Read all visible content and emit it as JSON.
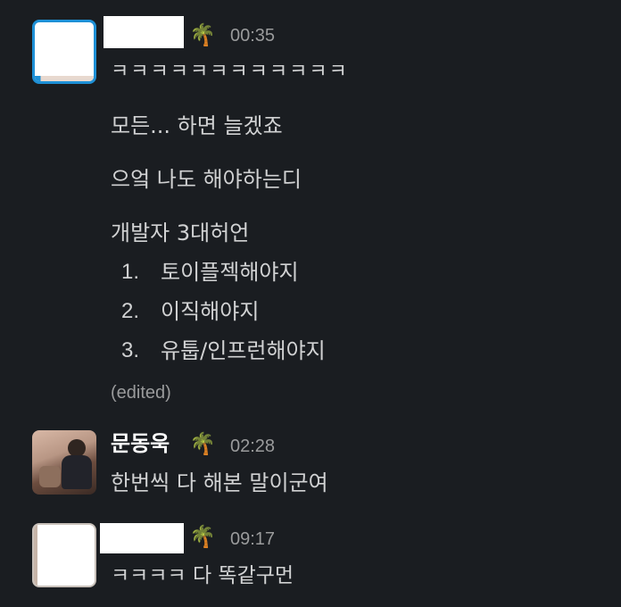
{
  "messages": [
    {
      "author": "",
      "author_status_emoji": "🌴",
      "time": "00:35",
      "lines": [
        "ㅋㅋㅋㅋㅋㅋㅋㅋㅋㅋㅋㅋ",
        "모든... 하면 늘겠죠",
        "으엌 나도 해야하는디",
        "개발자 3대허언"
      ],
      "list": [
        {
          "num": "1.",
          "text": "토이플젝해야지"
        },
        {
          "num": "2.",
          "text": "이직해야지"
        },
        {
          "num": "3.",
          "text": "유툽/인프런해야지"
        }
      ],
      "edited_label": "(edited)"
    },
    {
      "author": "문동욱",
      "author_status_emoji": "🌴",
      "time": "02:28",
      "lines": [
        "한번씩 다 해본 말이군여"
      ]
    },
    {
      "author": "",
      "author_status_emoji": "🌴",
      "time": "09:17",
      "lines": [
        "ㅋㅋㅋㅋ 다 똑같구먼"
      ]
    }
  ],
  "colors": {
    "background": "#1a1d21",
    "text": "#d1d2d3",
    "muted": "#9a9b9c",
    "avatar_border": "#1e90d6"
  }
}
